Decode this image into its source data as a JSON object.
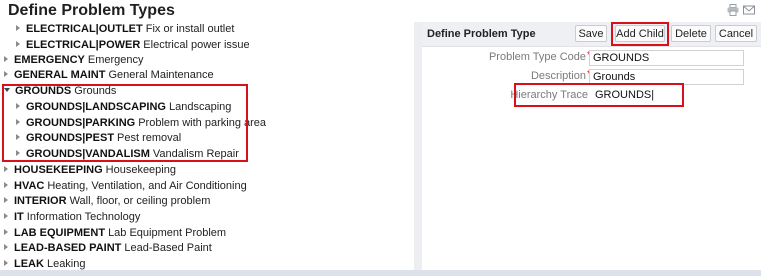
{
  "page": {
    "title": "Define Problem Types"
  },
  "title_icons": [
    "print-icon",
    "email-icon"
  ],
  "tree": {
    "rows": [
      {
        "code": "ELECTRICAL|OUTLET",
        "desc": "Fix or install outlet"
      },
      {
        "code": "ELECTRICAL|POWER",
        "desc": "Electrical power issue"
      },
      {
        "code": "EMERGENCY",
        "desc": "Emergency"
      },
      {
        "code": "GENERAL MAINT",
        "desc": "General Maintenance"
      },
      {
        "code": "GROUNDS",
        "desc": "Grounds"
      },
      {
        "code": "GROUNDS|LANDSCAPING",
        "desc": "Landscaping"
      },
      {
        "code": "GROUNDS|PARKING",
        "desc": "Problem with parking area"
      },
      {
        "code": "GROUNDS|PEST",
        "desc": "Pest removal"
      },
      {
        "code": "GROUNDS|VANDALISM",
        "desc": "Vandalism Repair"
      },
      {
        "code": "HOUSEKEEPING",
        "desc": "Housekeeping"
      },
      {
        "code": "HVAC",
        "desc": "Heating, Ventilation, and Air Conditioning"
      },
      {
        "code": "INTERIOR",
        "desc": "Wall, floor, or ceiling problem"
      },
      {
        "code": "IT",
        "desc": "Information Technology"
      },
      {
        "code": "LAB EQUIPMENT",
        "desc": "Lab Equipment Problem"
      },
      {
        "code": "LEAD-BASED PAINT",
        "desc": "Lead-Based Paint"
      },
      {
        "code": "LEAK",
        "desc": "Leaking"
      }
    ]
  },
  "form": {
    "title": "Define Problem Type",
    "buttons": {
      "save": "Save",
      "add_child": "Add Child",
      "delete": "Delete",
      "cancel": "Cancel"
    },
    "fields": {
      "code_label": "Problem Type Code",
      "code_value": "GROUNDS",
      "desc_label": "Description",
      "desc_value": "Grounds",
      "trace_label": "Hierarchy Trace",
      "trace_value": "GROUNDS|"
    },
    "required_marker": "*"
  },
  "colors": {
    "highlight": "#d8101c",
    "header_bg": "#eef0f3",
    "required": "#e0101a"
  }
}
